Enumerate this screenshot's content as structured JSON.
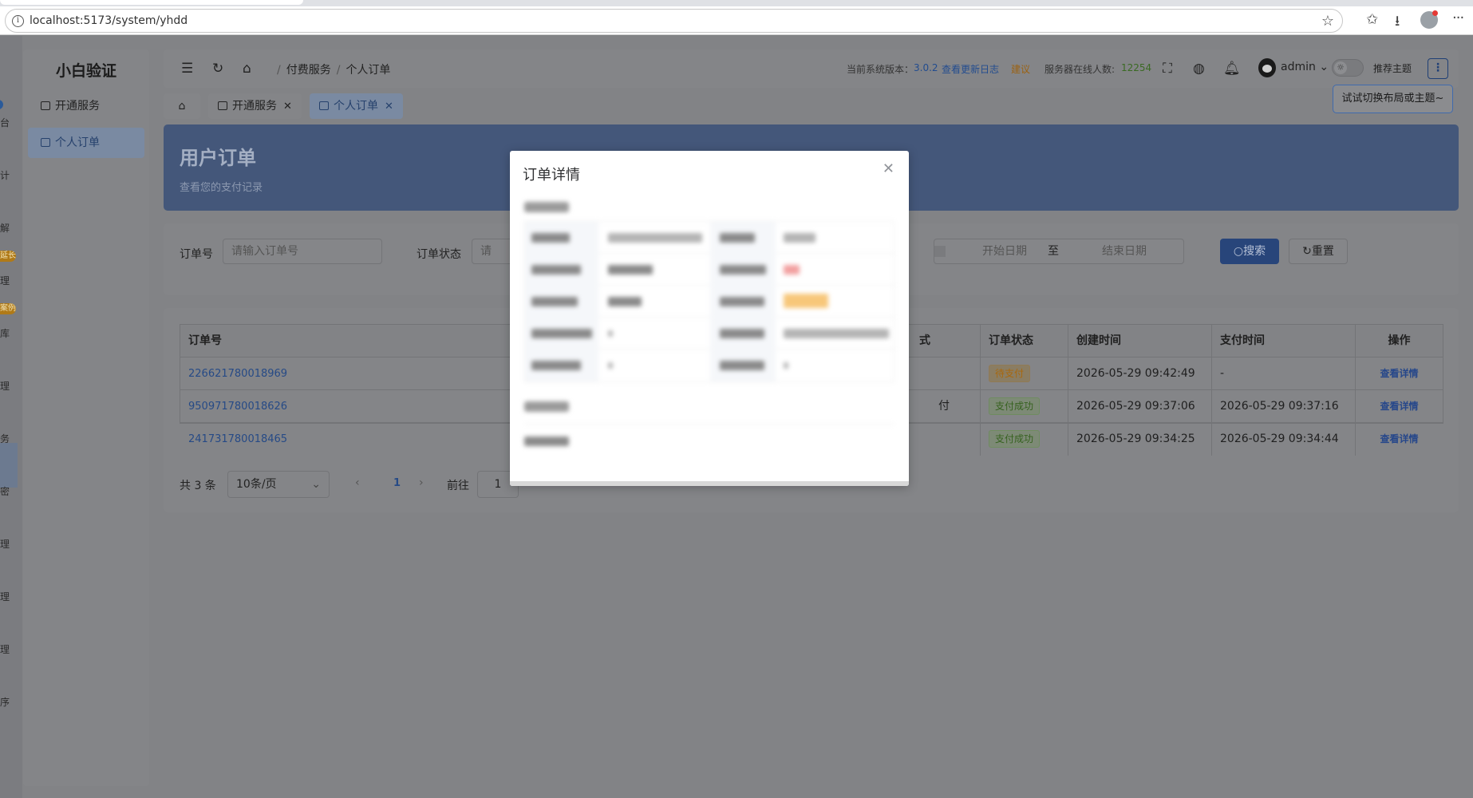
{
  "browser": {
    "url": "localhost:5173/system/yhdd"
  },
  "rail": {
    "labels": [
      "台",
      "计",
      "解",
      "理",
      "库",
      "理",
      "务",
      "密",
      "理",
      "理",
      "理",
      "序"
    ],
    "badges": [
      "延长",
      "案例"
    ]
  },
  "sidebar": {
    "brand": "小白验证",
    "items": [
      {
        "label": "开通服务",
        "active": false
      },
      {
        "label": "个人订单",
        "active": true
      }
    ]
  },
  "header": {
    "breadcrumb": [
      "付费服务",
      "个人订单"
    ],
    "version_label": "当前系统版本：",
    "version_value": "3.0.2",
    "changelog_link": "查看更新日志",
    "suggest_link": "建议",
    "online_label": "服务器在线人数:",
    "online_count": "12254",
    "user_name": "admin",
    "recommend_theme": "推荐主题",
    "tooltip": "试试切换布局或主题~"
  },
  "tabs": [
    {
      "label": "开通服务",
      "closable": true,
      "active": false
    },
    {
      "label": "个人订单",
      "closable": true,
      "active": true
    }
  ],
  "banner": {
    "title": "用户订单",
    "subtitle": "查看您的支付记录"
  },
  "search": {
    "order_no_label": "订单号",
    "order_no_placeholder": "请输入订单号",
    "status_label": "订单状态",
    "status_placeholder": "请",
    "start_date_placeholder": "开始日期",
    "date_separator": "至",
    "end_date_placeholder": "结束日期",
    "search_button": "搜索",
    "reset_button": "重置"
  },
  "table": {
    "headers": {
      "order_no": "订单号",
      "pay_method_partial": "式",
      "status": "订单状态",
      "created": "创建时间",
      "paid": "支付时间",
      "action": "操作"
    },
    "rows": [
      {
        "order_no": "226621780018969",
        "pay_method_partial": "",
        "status": "待支付",
        "status_type": "warning",
        "created": "2026-05-29 09:42:49",
        "paid": "-",
        "action": "查看详情"
      },
      {
        "order_no": "950971780018626",
        "pay_method_partial": "付",
        "status": "支付成功",
        "status_type": "success",
        "created": "2026-05-29 09:37:06",
        "paid": "2026-05-29 09:37:16",
        "action": "查看详情"
      },
      {
        "order_no": "241731780018465",
        "pay_method_partial": "",
        "status": "支付成功",
        "status_type": "success",
        "created": "2026-05-29 09:34:25",
        "paid": "2026-05-29 09:34:44",
        "action": "查看详情"
      }
    ]
  },
  "pager": {
    "total": "共 3 条",
    "page_size": "10条/页",
    "current_page": "1",
    "goto_label": "前往",
    "goto_value": "1"
  },
  "modal": {
    "title": "订单详情"
  },
  "colors": {
    "primary": "#3a5aa0",
    "banner": "#44577a",
    "success": "#67c23a",
    "warning": "#e6a23c"
  }
}
